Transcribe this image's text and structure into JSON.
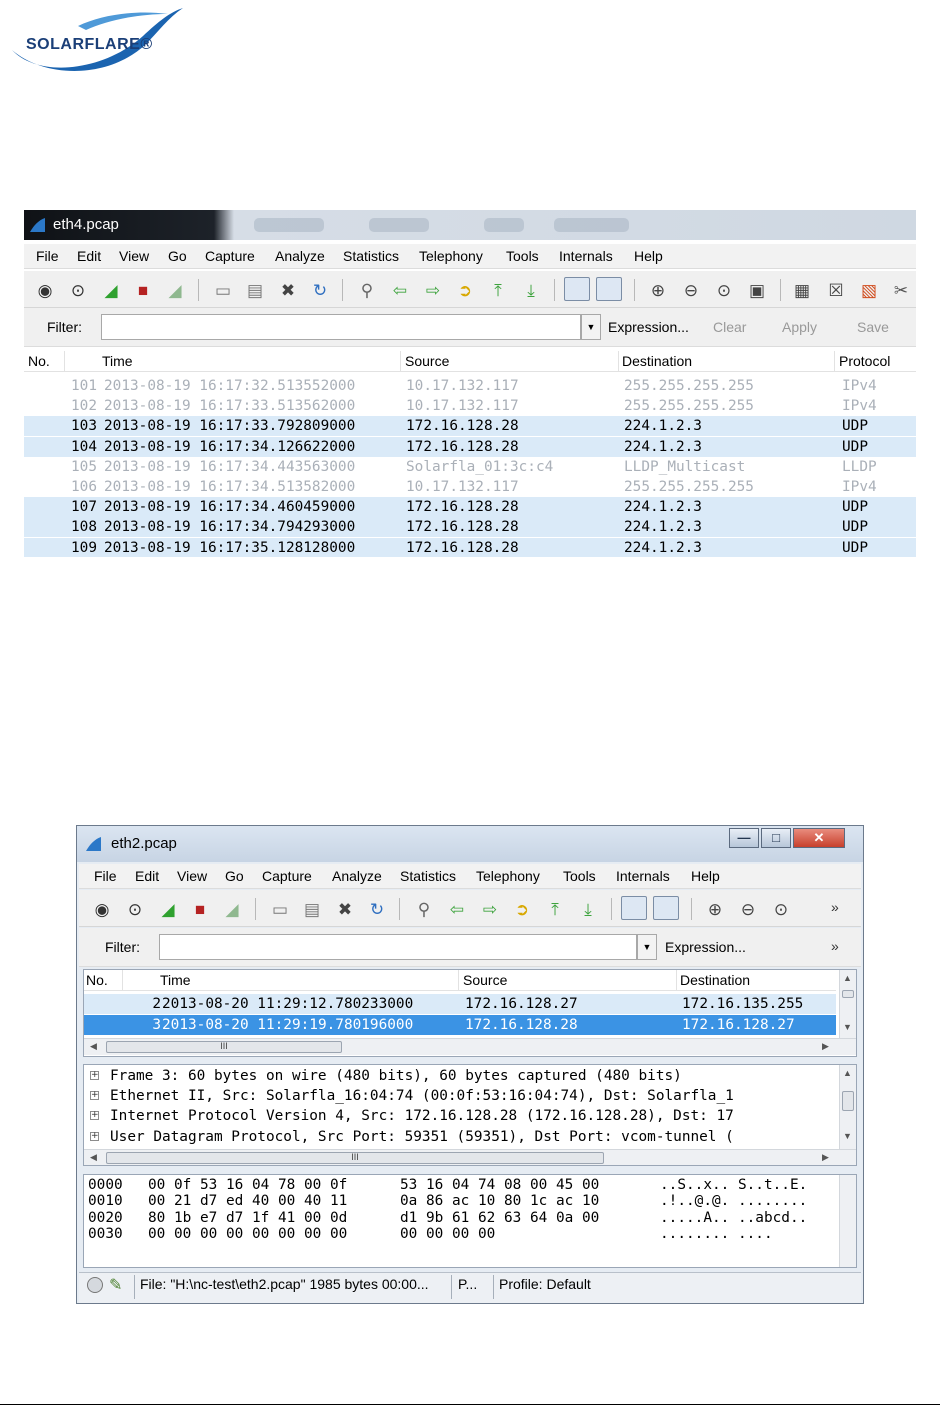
{
  "brand": {
    "name": "SOLARFLARE®"
  },
  "colors": {
    "udp_row": "#daeaf8",
    "selected_row": "#3b93e4",
    "dim_text": "#aab0b8",
    "logo_blue": "#1b64b0"
  },
  "menu": [
    "File",
    "Edit",
    "View",
    "Go",
    "Capture",
    "Analyze",
    "Statistics",
    "Telephony",
    "Tools",
    "Internals",
    "Help"
  ],
  "toolbar_icons": [
    "interface-list-icon",
    "capture-options-icon",
    "start-capture-icon",
    "stop-capture-icon",
    "restart-capture-icon",
    "open-file-icon",
    "save-file-icon",
    "close-file-icon",
    "reload-icon",
    "find-icon",
    "go-back-icon",
    "go-forward-icon",
    "go-to-packet-icon",
    "go-first-icon",
    "go-last-icon",
    "colorize-icon",
    "autoscroll-icon",
    "zoom-in-icon",
    "zoom-out-icon",
    "normal-size-icon",
    "resize-columns-icon",
    "capture-filters-icon",
    "display-filters-icon",
    "coloring-rules-icon",
    "preferences-icon"
  ],
  "screen1": {
    "title": "eth4.pcap",
    "filter": {
      "label": "Filter:",
      "value": "",
      "expression": "Expression...",
      "clear": "Clear",
      "apply": "Apply",
      "save": "Save"
    },
    "columns": [
      "No.",
      "Time",
      "Source",
      "Destination",
      "Protocol"
    ],
    "packets": [
      {
        "no": "101",
        "time": "2013-08-19 16:17:32.513552000",
        "source": "10.17.132.117",
        "destination": "255.255.255.255",
        "protocol": "IPv4",
        "style": "dim"
      },
      {
        "no": "102",
        "time": "2013-08-19 16:17:33.513562000",
        "source": "10.17.132.117",
        "destination": "255.255.255.255",
        "protocol": "IPv4",
        "style": "dim"
      },
      {
        "no": "103",
        "time": "2013-08-19 16:17:33.792809000",
        "source": "172.16.128.28",
        "destination": "224.1.2.3",
        "protocol": "UDP",
        "style": "udp"
      },
      {
        "no": "104",
        "time": "2013-08-19 16:17:34.126622000",
        "source": "172.16.128.28",
        "destination": "224.1.2.3",
        "protocol": "UDP",
        "style": "udp"
      },
      {
        "no": "105",
        "time": "2013-08-19 16:17:34.443563000",
        "source": "Solarfla_01:3c:c4",
        "destination": "LLDP_Multicast",
        "protocol": "LLDP",
        "style": "dim"
      },
      {
        "no": "106",
        "time": "2013-08-19 16:17:34.513582000",
        "source": "10.17.132.117",
        "destination": "255.255.255.255",
        "protocol": "IPv4",
        "style": "dim"
      },
      {
        "no": "107",
        "time": "2013-08-19 16:17:34.460459000",
        "source": "172.16.128.28",
        "destination": "224.1.2.3",
        "protocol": "UDP",
        "style": "udp"
      },
      {
        "no": "108",
        "time": "2013-08-19 16:17:34.794293000",
        "source": "172.16.128.28",
        "destination": "224.1.2.3",
        "protocol": "UDP",
        "style": "udp"
      },
      {
        "no": "109",
        "time": "2013-08-19 16:17:35.128128000",
        "source": "172.16.128.28",
        "destination": "224.1.2.3",
        "protocol": "UDP",
        "style": "udp"
      }
    ]
  },
  "screen2": {
    "title": "eth2.pcap",
    "window_buttons": {
      "minimize": "—",
      "maximize": "□",
      "close": "✕"
    },
    "overflow": "»",
    "filter": {
      "label": "Filter:",
      "value": "",
      "expression": "Expression..."
    },
    "columns": [
      "No.",
      "Time",
      "Source",
      "Destination"
    ],
    "packets": [
      {
        "no": "2",
        "time": "2013-08-20 11:29:12.780233000",
        "source": "172.16.128.27",
        "destination": "172.16.135.255",
        "style": "udp"
      },
      {
        "no": "3",
        "time": "2013-08-20 11:29:19.780196000",
        "source": "172.16.128.28",
        "destination": "172.16.128.27",
        "style": "sel"
      }
    ],
    "scroll_grip": "III",
    "tree": [
      "Frame 3: 60 bytes on wire (480 bits), 60 bytes captured (480 bits)",
      "Ethernet II, Src: Solarfla_16:04:74 (00:0f:53:16:04:74), Dst: Solarfla_1",
      "Internet Protocol Version 4, Src: 172.16.128.28 (172.16.128.28), Dst: 17",
      "User Datagram Protocol, Src Port: 59351 (59351), Dst Port: vcom-tunnel ("
    ],
    "hex": [
      {
        "offset": "0000",
        "bytes1": "00 0f 53 16 04 78 00 0f",
        "bytes2": "53 16 04 74 08 00 45 00",
        "ascii": "..S..x.. S..t..E."
      },
      {
        "offset": "0010",
        "bytes1": "00 21 d7 ed 40 00 40 11",
        "bytes2": "0a 86 ac 10 80 1c ac 10",
        "ascii": ".!..@.@. ........"
      },
      {
        "offset": "0020",
        "bytes1": "80 1b e7 d7 1f 41 00 0d",
        "bytes2": "d1 9b 61 62 63 64 0a 00",
        "ascii": ".....A.. ..abcd.."
      },
      {
        "offset": "0030",
        "bytes1": "00 00 00 00 00 00 00 00",
        "bytes2": "00 00 00 00",
        "ascii": "........ ...."
      }
    ],
    "status": {
      "file": "File: \"H:\\nc-test\\eth2.pcap\" 1985 bytes 00:00...",
      "packets": "P...",
      "profile": "Profile: Default"
    }
  }
}
